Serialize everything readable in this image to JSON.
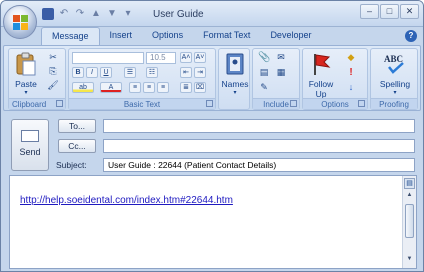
{
  "window": {
    "title": "User Guide"
  },
  "quick_access": [
    "save",
    "undo",
    "redo",
    "up",
    "down",
    "more"
  ],
  "tabs": [
    "Message",
    "Insert",
    "Options",
    "Format Text",
    "Developer"
  ],
  "active_tab": "Message",
  "ribbon": {
    "clipboard": {
      "label": "Clipboard",
      "paste": "Paste"
    },
    "basic_text": {
      "label": "Basic Text",
      "font_size": "10.5",
      "font_name": ""
    },
    "names": {
      "label": "Names"
    },
    "include": {
      "label": "Include"
    },
    "options": {
      "label": "Options",
      "follow_up": "Follow",
      "follow_up2": "Up"
    },
    "proofing": {
      "label": "Proofing",
      "spelling": "Spelling"
    }
  },
  "compose": {
    "send_label": "Send",
    "to_label": "To...",
    "cc_label": "Cc...",
    "subject_label": "Subject:",
    "to_value": "",
    "cc_value": "",
    "subject_value": "User Guide :  22644 (Patient Contact Details)"
  },
  "body": {
    "link": "http://help.soeidental.com/index.htm#22644.htm"
  },
  "colors": {
    "accent": "#15428b",
    "ribbon": "#dce8f7",
    "link": "#1f1ac0"
  }
}
